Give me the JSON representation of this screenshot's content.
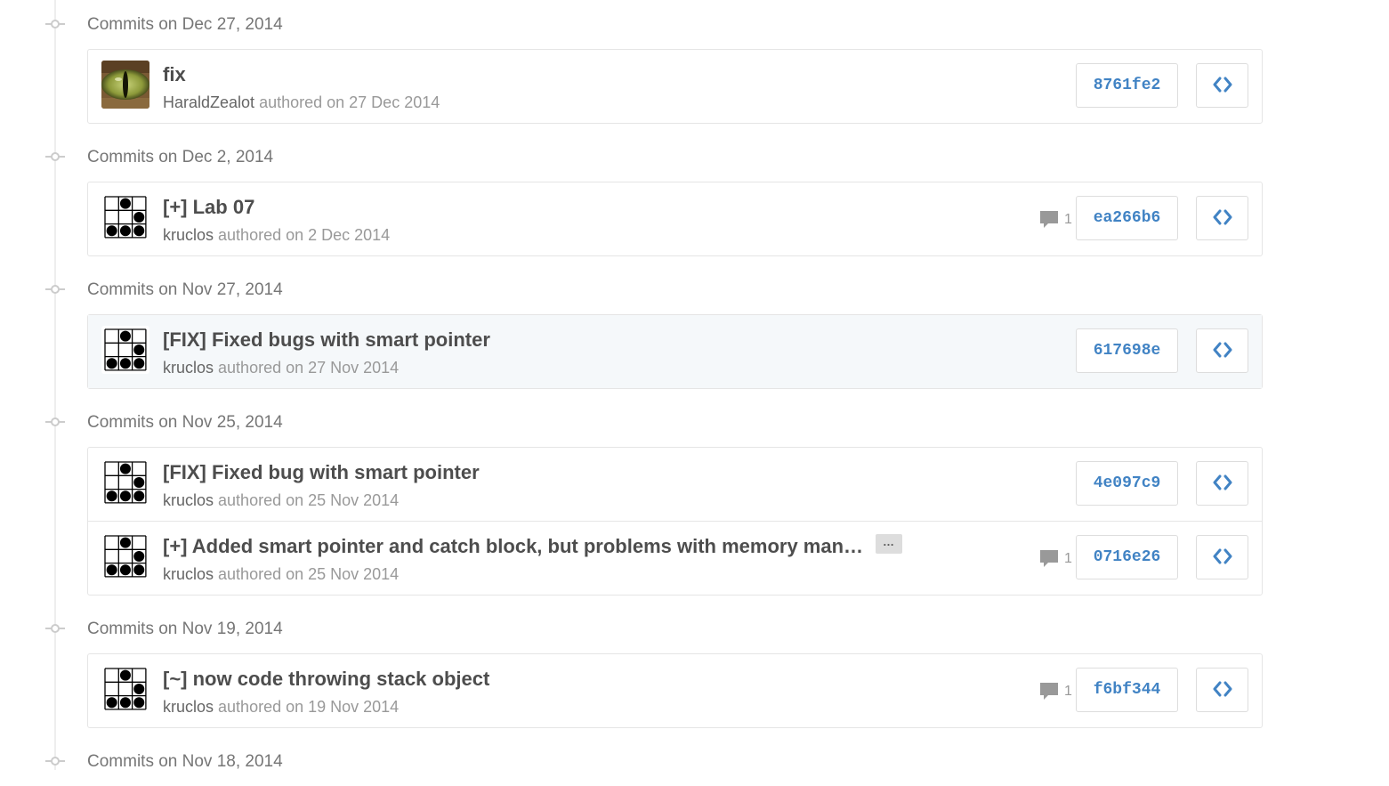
{
  "groups": [
    {
      "header": "Commits on Dec 27, 2014",
      "commits": [
        {
          "title": "fix",
          "author": "HaraldZealot",
          "authored": "authored on 27 Dec 2014",
          "sha": "8761fe2",
          "comments": null,
          "avatar": "cat-eye-avatar",
          "truncated": false,
          "highlight": false
        }
      ]
    },
    {
      "header": "Commits on Dec 2, 2014",
      "commits": [
        {
          "title": "[+] Lab 07",
          "author": "kruclos",
          "authored": "authored on 2 Dec 2014",
          "sha": "ea266b6",
          "comments": "1",
          "avatar": "glider-avatar",
          "truncated": false,
          "highlight": false
        }
      ]
    },
    {
      "header": "Commits on Nov 27, 2014",
      "commits": [
        {
          "title": "[FIX] Fixed bugs with smart pointer",
          "author": "kruclos",
          "authored": "authored on 27 Nov 2014",
          "sha": "617698e",
          "comments": null,
          "avatar": "glider-avatar",
          "truncated": false,
          "highlight": true
        }
      ]
    },
    {
      "header": "Commits on Nov 25, 2014",
      "commits": [
        {
          "title": "[FIX] Fixed bug with smart pointer",
          "author": "kruclos",
          "authored": "authored on 25 Nov 2014",
          "sha": "4e097c9",
          "comments": null,
          "avatar": "glider-avatar",
          "truncated": false,
          "highlight": false
        },
        {
          "title": "[+] Added smart pointer and catch block, but problems with memory man…",
          "author": "kruclos",
          "authored": "authored on 25 Nov 2014",
          "sha": "0716e26",
          "comments": "1",
          "avatar": "glider-avatar",
          "truncated": true,
          "highlight": false
        }
      ]
    },
    {
      "header": "Commits on Nov 19, 2014",
      "commits": [
        {
          "title": "[~] now code throwing stack object",
          "author": "kruclos",
          "authored": "authored on 19 Nov 2014",
          "sha": "f6bf344",
          "comments": "1",
          "avatar": "glider-avatar",
          "truncated": false,
          "highlight": false
        }
      ]
    },
    {
      "header": "Commits on Nov 18, 2014",
      "commits": []
    }
  ],
  "ellipsis_label": "…",
  "colors": {
    "link": "#4183c4",
    "muted": "#999999",
    "title": "#4d4d4d",
    "border": "#e5e5e5",
    "highlight_bg": "#f5f8fa"
  },
  "icons": {
    "comment": "comment-icon",
    "browse": "code-icon",
    "timeline_node": "commit-node-icon"
  }
}
